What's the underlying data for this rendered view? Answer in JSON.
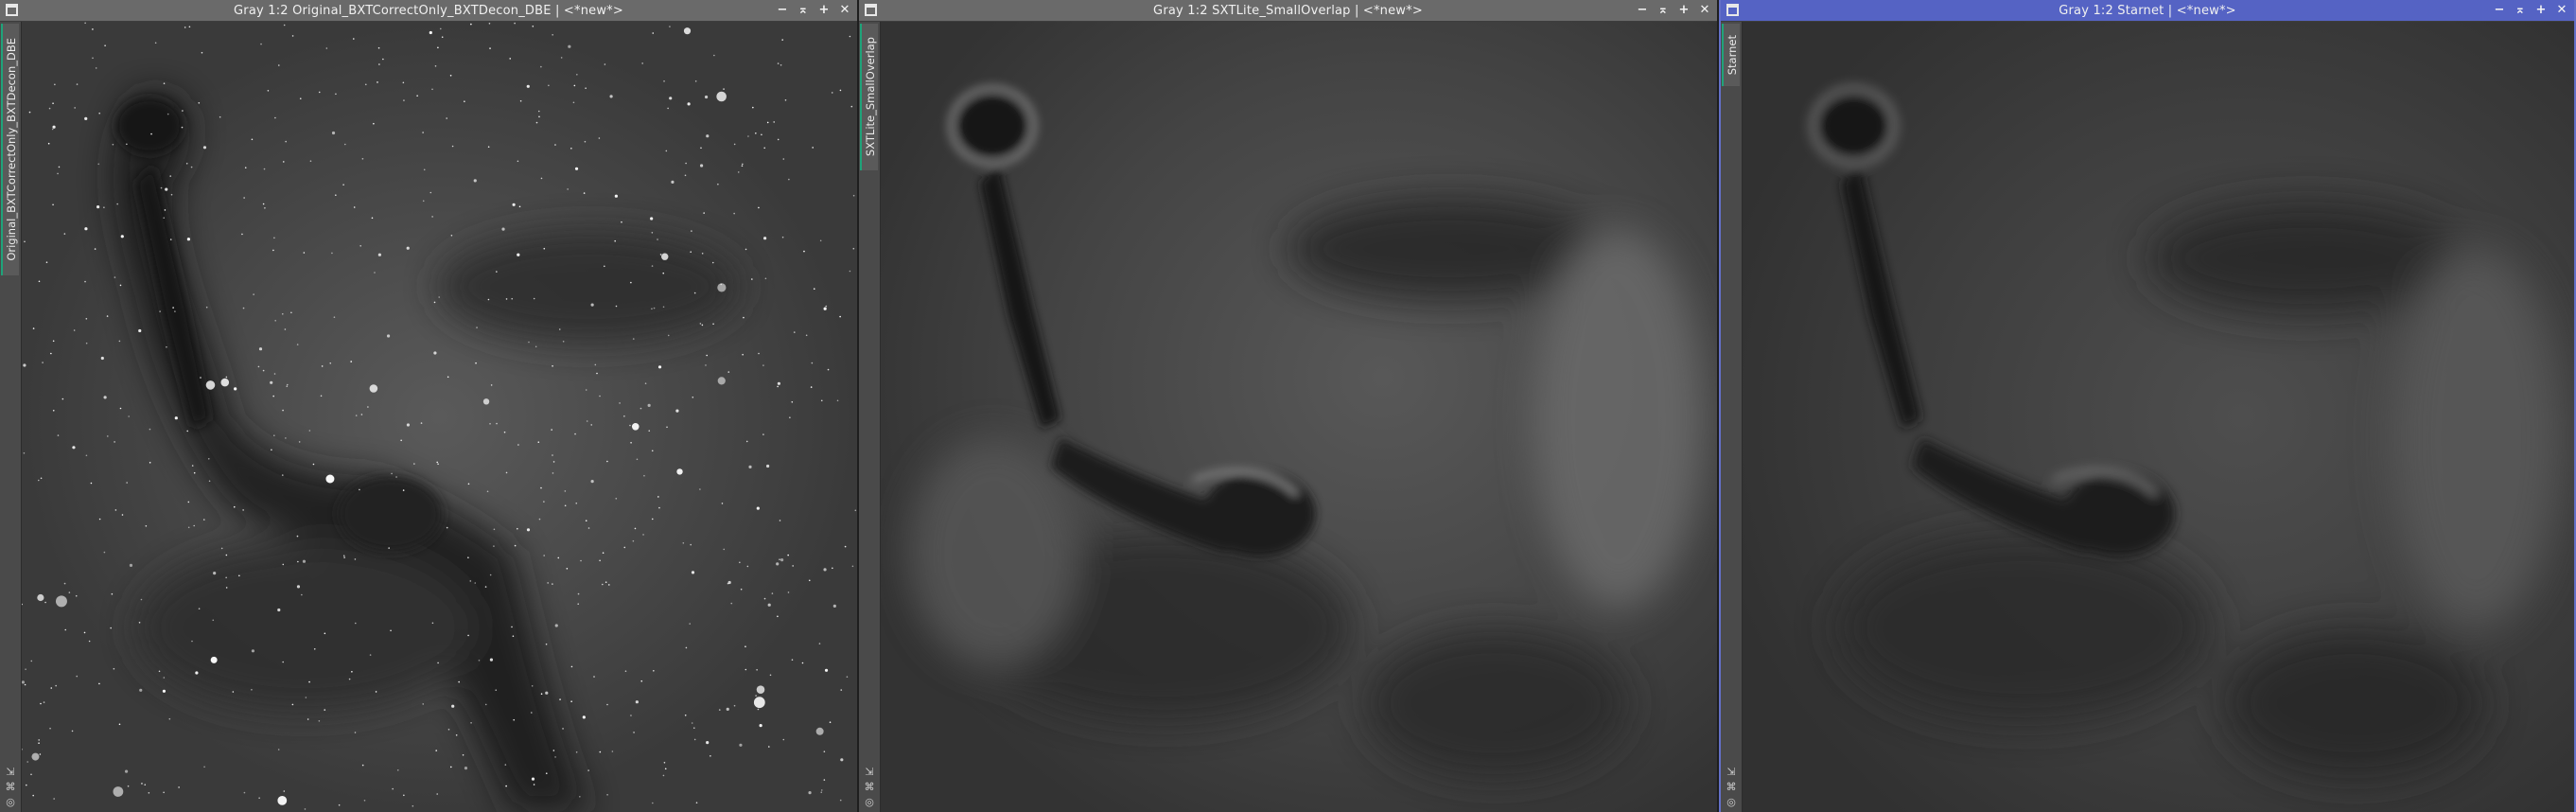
{
  "windows": [
    {
      "title": "Gray 1:2 Original_BXTCorrectOnly_BXTDecon_DBE | <*new*>",
      "tab": "Original_BXTCorrectOnly_BXTDecon_DBE",
      "active": false
    },
    {
      "title": "Gray 1:2 SXTLite_SmallOverlap | <*new*>",
      "tab": "SXTLite_SmallOverlap",
      "active": false
    },
    {
      "title": "Gray 1:2 Starnet | <*new*>",
      "tab": "Starnet",
      "active": true
    }
  ],
  "controls": {
    "minimize": "−",
    "shade": "⌅",
    "maximize": "+",
    "close": "✕"
  },
  "strip_icons": [
    "⇲",
    "⌘",
    "◎"
  ],
  "colors": {
    "titlebar": "#6a6a6a",
    "active_titlebar": "#5563c4",
    "tab_accent": "#1fa37a",
    "background": "#2a2a2a"
  }
}
